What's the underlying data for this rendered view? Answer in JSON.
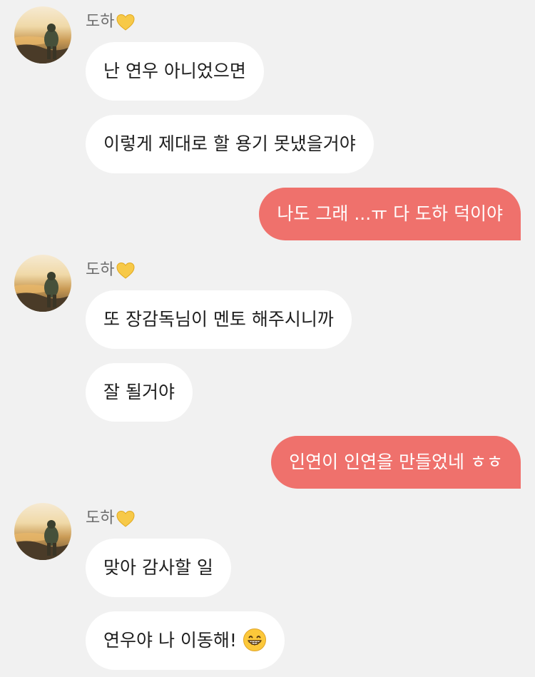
{
  "chat": {
    "messages": [
      {
        "sender": "도하",
        "text": "난 연우 아니었으면"
      },
      {
        "sender": "도하",
        "text": "이렇게 제대로 할 용기 못냈을거야"
      },
      {
        "sender": "me",
        "text": "나도 그래 ...ㅠ 다 도하 덕이야"
      },
      {
        "sender": "도하",
        "text": "또 장감독님이 멘토 해주시니까"
      },
      {
        "sender": "도하",
        "text": "잘 될거야"
      },
      {
        "sender": "me",
        "text": "인연이 인연을 만들었네 ㅎㅎ"
      },
      {
        "sender": "도하",
        "text": "맞아 감사할 일"
      },
      {
        "sender": "도하",
        "text": "연우야 나 이동해!",
        "emoji": "grinning-face-emoji"
      }
    ],
    "contact": {
      "name": "도하",
      "name_icon": "yellow-heart-icon",
      "avatar": "sunset-silhouette-avatar"
    },
    "colors": {
      "background": "#f1f1f1",
      "incoming_bubble": "#ffffff",
      "outgoing_bubble": "#ef716c",
      "sender_name": "#6e6e6e"
    }
  }
}
